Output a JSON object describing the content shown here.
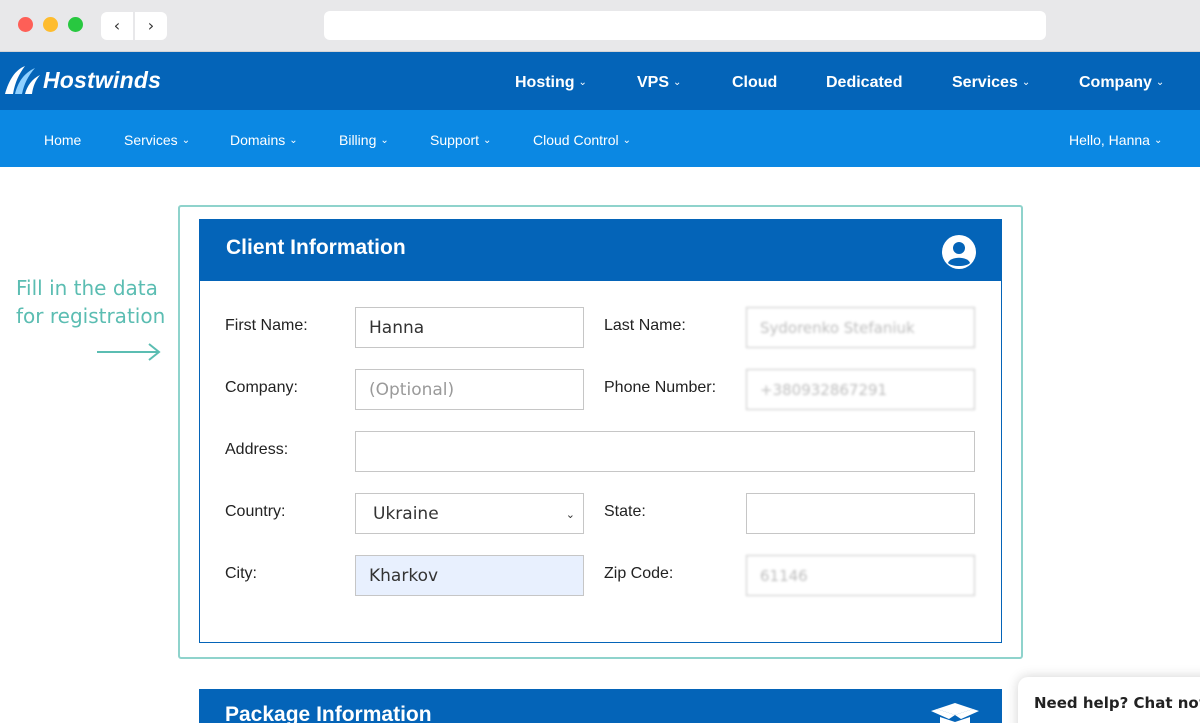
{
  "browser": {
    "back_glyph": "‹",
    "forward_glyph": "›"
  },
  "site": {
    "logo": "Hostwinds"
  },
  "main_nav": [
    {
      "label": "Hosting",
      "dropdown": "⌄"
    },
    {
      "label": "VPS",
      "dropdown": "⌄"
    },
    {
      "label": "Cloud"
    },
    {
      "label": "Dedicated"
    },
    {
      "label": "Services",
      "dropdown": "⌄"
    },
    {
      "label": "Company",
      "dropdown": "⌄"
    }
  ],
  "sub_nav": [
    {
      "label": "Home"
    },
    {
      "label": "Services",
      "dropdown": "⌄"
    },
    {
      "label": "Domains",
      "dropdown": "⌄"
    },
    {
      "label": "Billing",
      "dropdown": "⌄"
    },
    {
      "label": "Support",
      "dropdown": "⌄"
    },
    {
      "label": "Cloud Control",
      "dropdown": "⌄"
    }
  ],
  "account_menu": {
    "label": "Hello, Hanna",
    "dropdown": "⌄"
  },
  "annotation": {
    "line1": "Fill in the data",
    "line2": "for registration"
  },
  "client_info": {
    "title": "Client Information",
    "icon": "user-circle-icon",
    "fields": {
      "first_name": {
        "label": "First Name:",
        "value": "Hanna"
      },
      "last_name": {
        "label": "Last Name:",
        "value": "Sydorenko Stefaniuk"
      },
      "company": {
        "label": "Company:",
        "placeholder": "(Optional)"
      },
      "phone": {
        "label": "Phone Number:",
        "value": "+380932867291"
      },
      "address": {
        "label": "Address:",
        "value": ""
      },
      "country": {
        "label": "Country:",
        "value": "Ukraine",
        "dropdown": "⌄"
      },
      "state": {
        "label": "State:",
        "value": ""
      },
      "city": {
        "label": "City:",
        "value": "Kharkov"
      },
      "zip": {
        "label": "Zip Code:",
        "value": "61146"
      }
    }
  },
  "package_info": {
    "title": "Package Information",
    "icon": "box-icon"
  },
  "chat": {
    "label": "Need help? Chat now!"
  },
  "colors": {
    "brand_dark": "#0464b8",
    "brand_light": "#0b88e3",
    "accent_teal": "#5bbdb2",
    "field_highlight": "#e8f0fe"
  }
}
